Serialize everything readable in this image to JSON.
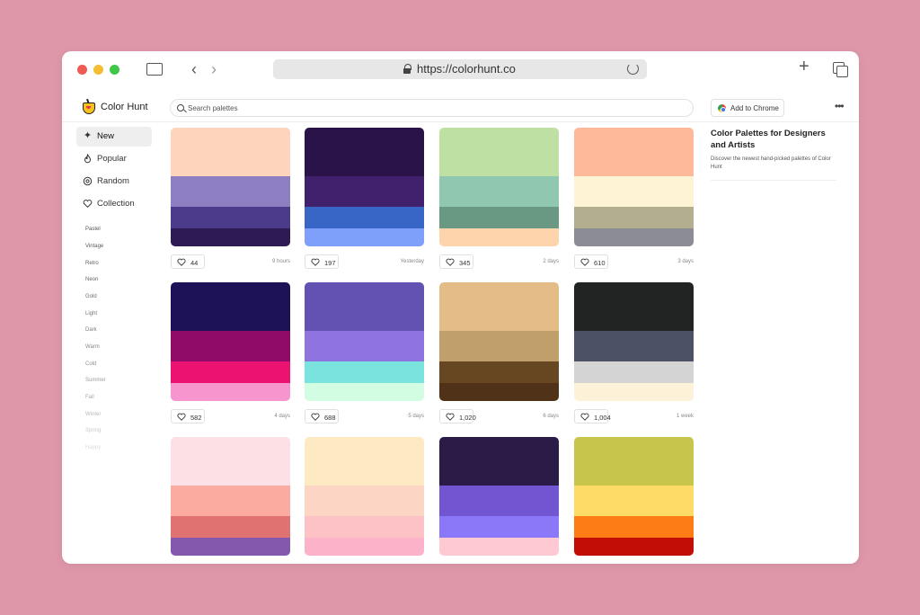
{
  "browser": {
    "url": "https://colorhunt.co"
  },
  "app": {
    "brand": "Color Hunt"
  },
  "search": {
    "placeholder": "Search palettes"
  },
  "header": {
    "add_to_chrome": "Add to Chrome",
    "more_icon": "more-icon"
  },
  "sidebar": {
    "items": [
      {
        "label": "New",
        "icon": "sparkle-icon",
        "active": true
      },
      {
        "label": "Popular",
        "icon": "flame-icon",
        "active": false
      },
      {
        "label": "Random",
        "icon": "random-icon",
        "active": false
      },
      {
        "label": "Collection",
        "icon": "heart-icon",
        "active": false
      }
    ],
    "tags": [
      "Pastel",
      "Vintage",
      "Retro",
      "Neon",
      "Gold",
      "Light",
      "Dark",
      "Warm",
      "Cold",
      "Summer",
      "Fall",
      "Winter",
      "Spring",
      "Happy"
    ]
  },
  "palettes": [
    {
      "colors": [
        "#fed4bc",
        "#8e7fc3",
        "#4c3a8a",
        "#2d1b55"
      ],
      "likes": "44",
      "time": "9 hours"
    },
    {
      "colors": [
        "#2a1349",
        "#41206e",
        "#3766c7",
        "#7ea0fb"
      ],
      "likes": "197",
      "time": "Yesterday"
    },
    {
      "colors": [
        "#bfe0a3",
        "#8fc7b1",
        "#6a9983",
        "#fed4ac"
      ],
      "likes": "345",
      "time": "2 days"
    },
    {
      "colors": [
        "#fdb99a",
        "#fef3d5",
        "#b4ae91",
        "#8c8c94"
      ],
      "likes": "610",
      "time": "3 days"
    },
    {
      "colors": [
        "#1d1258",
        "#900a68",
        "#ec1271",
        "#f795cf"
      ],
      "likes": "582",
      "time": "4 days"
    },
    {
      "colors": [
        "#6352b2",
        "#8f74e0",
        "#7be3dd",
        "#d3fde3"
      ],
      "likes": "688",
      "time": "5 days"
    },
    {
      "colors": [
        "#e4bc88",
        "#c19f6a",
        "#664721",
        "#4f3218"
      ],
      "likes": "1,020",
      "time": "6 days"
    },
    {
      "colors": [
        "#222424",
        "#4d5166",
        "#d4d4d4",
        "#fdf1d8"
      ],
      "likes": "1,004",
      "time": "1 week"
    },
    {
      "colors": [
        "#fde0e6",
        "#fcaba0",
        "#e07272",
        "#8358ad"
      ],
      "likes": "",
      "time": ""
    },
    {
      "colors": [
        "#fdeac2",
        "#fdd5c4",
        "#fcc2c6",
        "#fcb2c8"
      ],
      "likes": "",
      "time": ""
    },
    {
      "colors": [
        "#2a1c46",
        "#7256d1",
        "#8a78f8",
        "#fec9d3"
      ],
      "likes": "",
      "time": ""
    },
    {
      "colors": [
        "#c8c54c",
        "#fddb66",
        "#fd7c15",
        "#c10d06"
      ],
      "likes": "",
      "time": ""
    }
  ],
  "right_panel": {
    "title": "Color Palettes for Designers and Artists",
    "description": "Discover the newest hand-picked palettes of Color Hunt"
  }
}
